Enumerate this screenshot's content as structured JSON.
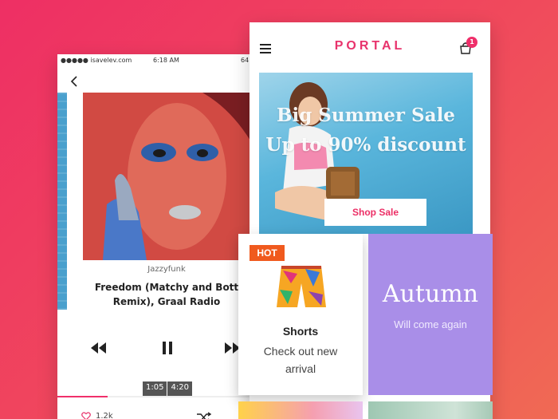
{
  "music_player": {
    "status_bar": {
      "carrier": "●●●●● isavelev.com",
      "time": "6:18 AM",
      "battery": "64"
    },
    "icons": {
      "back": "chevron-left-icon",
      "prev": "rewind-icon",
      "play": "pause-icon",
      "next": "fast-forward-icon",
      "like": "heart-icon",
      "shuffle": "shuffle-icon"
    },
    "genre": "Jazzyfunk",
    "track_title": "Freedom (Matchy and Bott Remix), Graal Radio",
    "elapsed": "1:05",
    "duration": "4:20",
    "progress_fraction": 0.25,
    "likes": "1.2k",
    "accent": "#f0306a"
  },
  "portal": {
    "brand": "PORTAL",
    "cart_count": "1",
    "icons": {
      "menu": "hamburger-menu-icon",
      "cart": "shopping-bag-icon"
    },
    "hero": {
      "title": "Big Summer Sale Up to 90% discount",
      "cta": "Shop Sale"
    },
    "accent": "#e8336c"
  },
  "cards": {
    "shorts": {
      "badge": "HOT",
      "title": "Shorts",
      "subtitle": "Check out new arrival",
      "badge_color": "#f05a1e"
    },
    "autumn": {
      "title": "Autumn",
      "subtitle": "Will come again",
      "bg": "#a98ee8"
    }
  },
  "background": {
    "from": "#ee2f64",
    "to": "#f06a54"
  }
}
